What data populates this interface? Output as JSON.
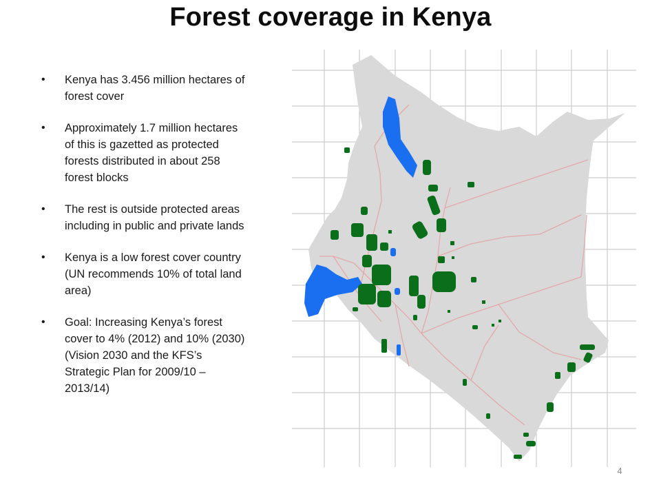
{
  "title": "Forest coverage in Kenya",
  "bullets": [
    "Kenya has 3.456 million hectares of forest cover",
    "Approximately 1.7 million hectares of this is gazetted as protected forests distributed in about 258 forest blocks",
    "The rest is outside protected areas including in public and private lands",
    "Kenya is a low forest cover country (UN recommends 10% of total land area)",
    "Goal: Increasing Kenya’s forest cover to 4% (2012) and 10% (2030) (Vision 2030 and the KFS’s Strategic Plan for 2009/10 – 2013/14)"
  ],
  "map": {
    "land_color": "#d9d9d9",
    "forest_color": "#0a6e1a",
    "water_color": "#1a6ff0",
    "road_color": "#e3a9a9",
    "grid_color": "#c2c2c2"
  },
  "page_number": "4"
}
